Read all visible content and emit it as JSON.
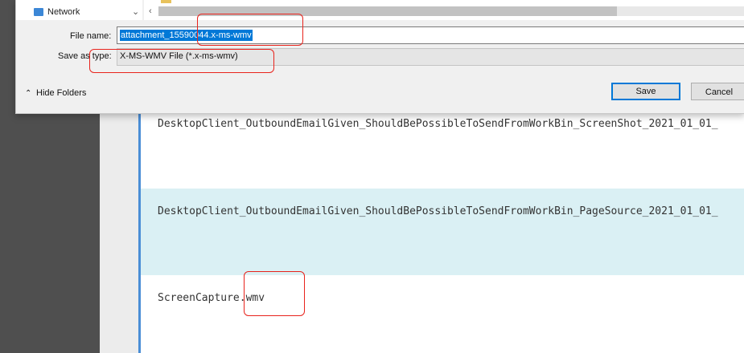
{
  "app": {
    "rows": [
      {
        "text": "DesktopClient_OutboundEmailGiven_ShouldBePossibleToSendFromWorkBin_ScreenShot_2021_01_01_"
      },
      {
        "text": "DesktopClient_OutboundEmailGiven_ShouldBePossibleToSendFromWorkBin_PageSource_2021_01_01_"
      },
      {
        "text": "ScreenCapture.wmv"
      }
    ],
    "accent_color": "#4a8ed6",
    "highlight_row_color": "#daf0f4"
  },
  "dialog": {
    "nav_tree": {
      "item_label": "Network",
      "item_icon": "network-icon"
    },
    "file_name_label": "File name:",
    "file_name_value": "attachment_15590044.x-ms-wmv",
    "save_as_type_label": "Save as type:",
    "save_as_type_value": "X-MS-WMV File (*.x-ms-wmv)",
    "hide_folders_label": "Hide Folders",
    "save_button": "Save",
    "cancel_button": "Cancel",
    "selection_color": "#0078d7"
  },
  "annotations": {
    "color": "#e8231c"
  }
}
